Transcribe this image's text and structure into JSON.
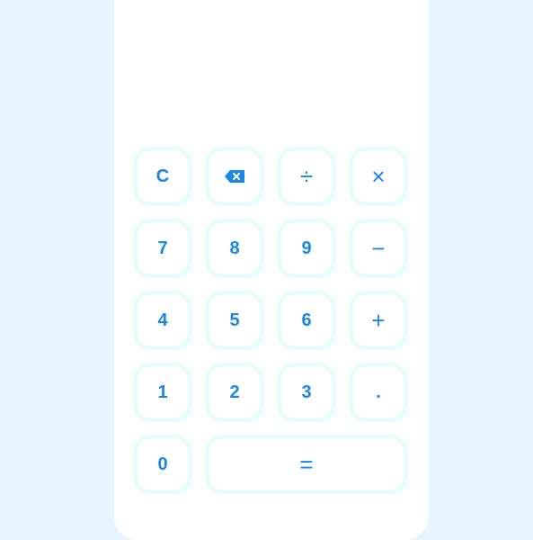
{
  "display": {
    "value": ""
  },
  "keys": {
    "clear": "C",
    "backspace_icon": "backspace-icon",
    "divide": "÷",
    "multiply": "×",
    "seven": "7",
    "eight": "8",
    "nine": "9",
    "minus": "−",
    "four": "4",
    "five": "5",
    "six": "6",
    "plus": "+",
    "one": "1",
    "two": "2",
    "three": "3",
    "decimal": ".",
    "zero": "0",
    "equals": "="
  },
  "colors": {
    "page_background": "#e6f4ff",
    "card_background": "#ffffff",
    "key_text": "#1a86e8",
    "key_glow": "#78ebff"
  }
}
